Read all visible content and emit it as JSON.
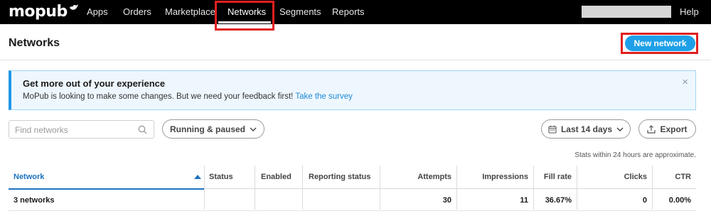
{
  "brand": {
    "logo_text": "mopub"
  },
  "nav": {
    "items": [
      {
        "label": "Apps"
      },
      {
        "label": "Orders"
      },
      {
        "label": "Marketplace"
      },
      {
        "label": "Networks"
      },
      {
        "label": "Segments"
      },
      {
        "label": "Reports"
      }
    ],
    "active": "Networks",
    "help": "Help"
  },
  "header": {
    "title": "Networks",
    "new_button": "New network"
  },
  "banner": {
    "title": "Get more out of your experience",
    "text": "MoPub is looking to make some changes. But we need your feedback first!",
    "link": "Take the survey",
    "close": "×"
  },
  "filters": {
    "search_placeholder": "Find networks",
    "status_filter": "Running & paused",
    "date_range": "Last 14 days",
    "export": "Export"
  },
  "note": "Stats within 24 hours are approximate.",
  "table": {
    "columns": [
      "Network",
      "Status",
      "Enabled",
      "Reporting status",
      "Attempts",
      "Impressions",
      "Fill rate",
      "Clicks",
      "CTR"
    ],
    "sort": {
      "column": "Network",
      "direction": "ascending"
    },
    "summary_row": {
      "network": "3 networks",
      "status": "",
      "enabled": "",
      "reporting_status": "",
      "attempts": "30",
      "impressions": "11",
      "fill_rate": "36.67%",
      "clicks": "0",
      "ctr": "0.00%"
    }
  },
  "colors": {
    "nav_bg": "#000000",
    "primary_button": "#1ea0e8",
    "highlight": "#e0201f",
    "banner_accent": "#2196e8",
    "link": "#1e88d6"
  }
}
